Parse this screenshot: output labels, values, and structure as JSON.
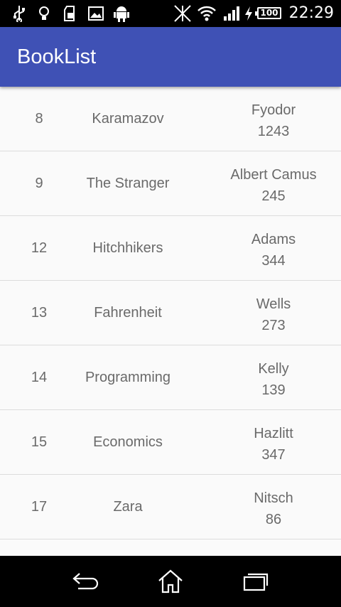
{
  "status_bar": {
    "time": "22:29",
    "battery": "100",
    "icons": [
      "usb-icon",
      "lightbulb-icon",
      "sd-card-icon",
      "image-icon",
      "android-icon",
      "no-signal-icon",
      "wifi-icon",
      "cell-signal-icon",
      "charging-icon",
      "battery-icon"
    ]
  },
  "app_bar": {
    "title": "BookList",
    "color": "#3f51b5"
  },
  "books": [
    {
      "id": "8",
      "title": "Karamazov",
      "author": "Fyodor",
      "pages": "1243"
    },
    {
      "id": "9",
      "title": "The Stranger",
      "author": "Albert Camus",
      "pages": "245"
    },
    {
      "id": "12",
      "title": "Hitchhikers",
      "author": "Adams",
      "pages": "344"
    },
    {
      "id": "13",
      "title": "Fahrenheit",
      "author": "Wells",
      "pages": "273"
    },
    {
      "id": "14",
      "title": "Programming",
      "author": "Kelly",
      "pages": "139"
    },
    {
      "id": "15",
      "title": "Economics",
      "author": "Hazlitt",
      "pages": "347"
    },
    {
      "id": "17",
      "title": "Zara",
      "author": "Nitsch",
      "pages": "86"
    }
  ],
  "nav_bar": {
    "buttons": [
      "back-icon",
      "home-icon",
      "recents-icon"
    ]
  }
}
